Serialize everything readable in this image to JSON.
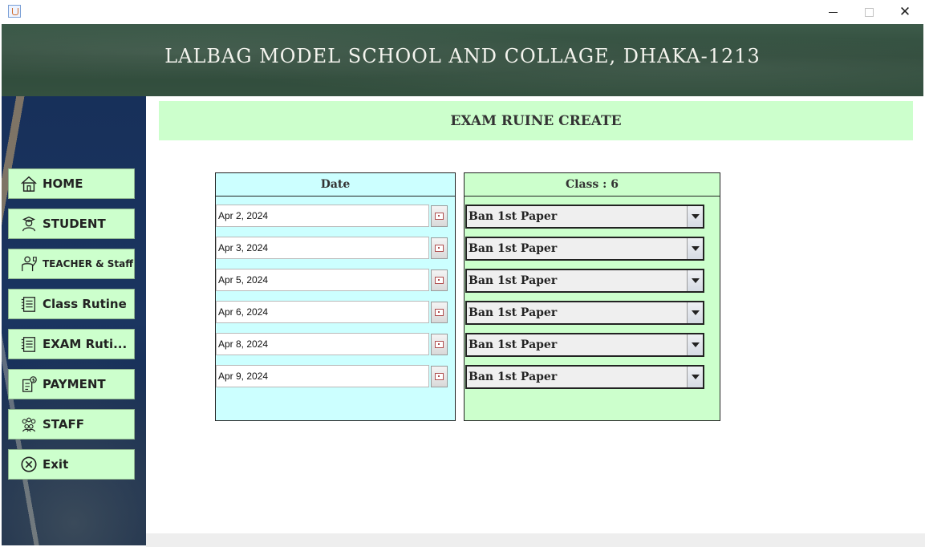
{
  "window": {
    "minimize_glyph": "minimize",
    "maximize_glyph": "maximize",
    "close_glyph": "✕"
  },
  "header": {
    "title": "LALBAG MODEL SCHOOL AND COLLAGE, DHAKA-1213"
  },
  "sidebar": {
    "items": [
      {
        "label": "HOME",
        "icon": "home-icon"
      },
      {
        "label": "STUDENT",
        "icon": "student-icon"
      },
      {
        "label": "TEACHER & Staff",
        "icon": "teacher-icon"
      },
      {
        "label": "Class Rutine",
        "icon": "routine-icon"
      },
      {
        "label": "EXAM Ruti...",
        "icon": "exam-routine-icon"
      },
      {
        "label": "PAYMENT",
        "icon": "payment-icon"
      },
      {
        "label": "STAFF",
        "icon": "staff-icon"
      },
      {
        "label": "Exit",
        "icon": "exit-icon"
      }
    ]
  },
  "page": {
    "title": "EXAM RUINE CREATE"
  },
  "date_panel": {
    "header": "Date",
    "dates": [
      "Apr 2, 2024",
      "Apr 3, 2024",
      "Apr 5, 2024",
      "Apr 6, 2024",
      "Apr 8, 2024",
      "Apr 9, 2024"
    ]
  },
  "class_panel": {
    "header": "Class : 6",
    "subjects": [
      "Ban 1st Paper",
      "Ban 1st Paper",
      "Ban 1st Paper",
      "Ban 1st Paper",
      "Ban 1st Paper",
      "Ban 1st Paper"
    ]
  },
  "colors": {
    "nav_button_bg": "#ccffcc",
    "date_panel_bg": "#ccffff",
    "class_panel_bg": "#ccffcc",
    "header_bg": "#34503f",
    "sidebar_bg": "#17305a"
  }
}
